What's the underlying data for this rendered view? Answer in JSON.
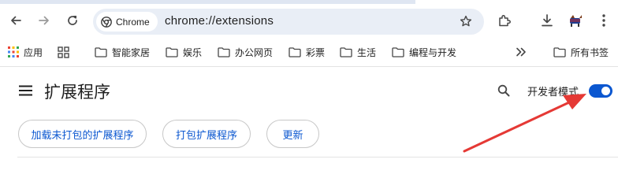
{
  "browser": {
    "nav": {
      "back_icon": "arrow-left-icon",
      "forward_icon": "arrow-right-icon",
      "reload_icon": "reload-icon"
    },
    "omnibox": {
      "chip_label": "Chrome",
      "url": "chrome://extensions",
      "bookmark_icon": "star-icon"
    },
    "toolbar_icons": [
      "extensions-puzzle-icon",
      "download-icon",
      "profile-avatar-icon",
      "more-vertical-icon"
    ]
  },
  "bookmarks": {
    "items": [
      {
        "label": "应用",
        "icon": "apps-grid-icon"
      },
      {
        "label": "",
        "icon": "tab-groups-icon"
      },
      {
        "label": "智能家居",
        "icon": "folder-icon"
      },
      {
        "label": "娱乐",
        "icon": "folder-icon"
      },
      {
        "label": "办公网页",
        "icon": "folder-icon"
      },
      {
        "label": "彩票",
        "icon": "folder-icon"
      },
      {
        "label": "生活",
        "icon": "folder-icon"
      },
      {
        "label": "编程与开发",
        "icon": "folder-icon"
      }
    ],
    "overflow_icon": "chevron-double-right-icon",
    "all_bookmarks": {
      "label": "所有书签",
      "icon": "folder-icon"
    }
  },
  "extensions_page": {
    "title": "扩展程序",
    "menu_icon": "hamburger-menu-icon",
    "search_icon": "search-icon",
    "developer_mode": {
      "label": "开发者模式",
      "enabled": true
    },
    "actions": {
      "load_unpacked": "加载未打包的扩展程序",
      "pack_extension": "打包扩展程序",
      "update": "更新"
    }
  },
  "colors": {
    "accent": "#0b57d0",
    "annotation_arrow": "#e53935",
    "omnibox_bg": "#e9eef6"
  }
}
